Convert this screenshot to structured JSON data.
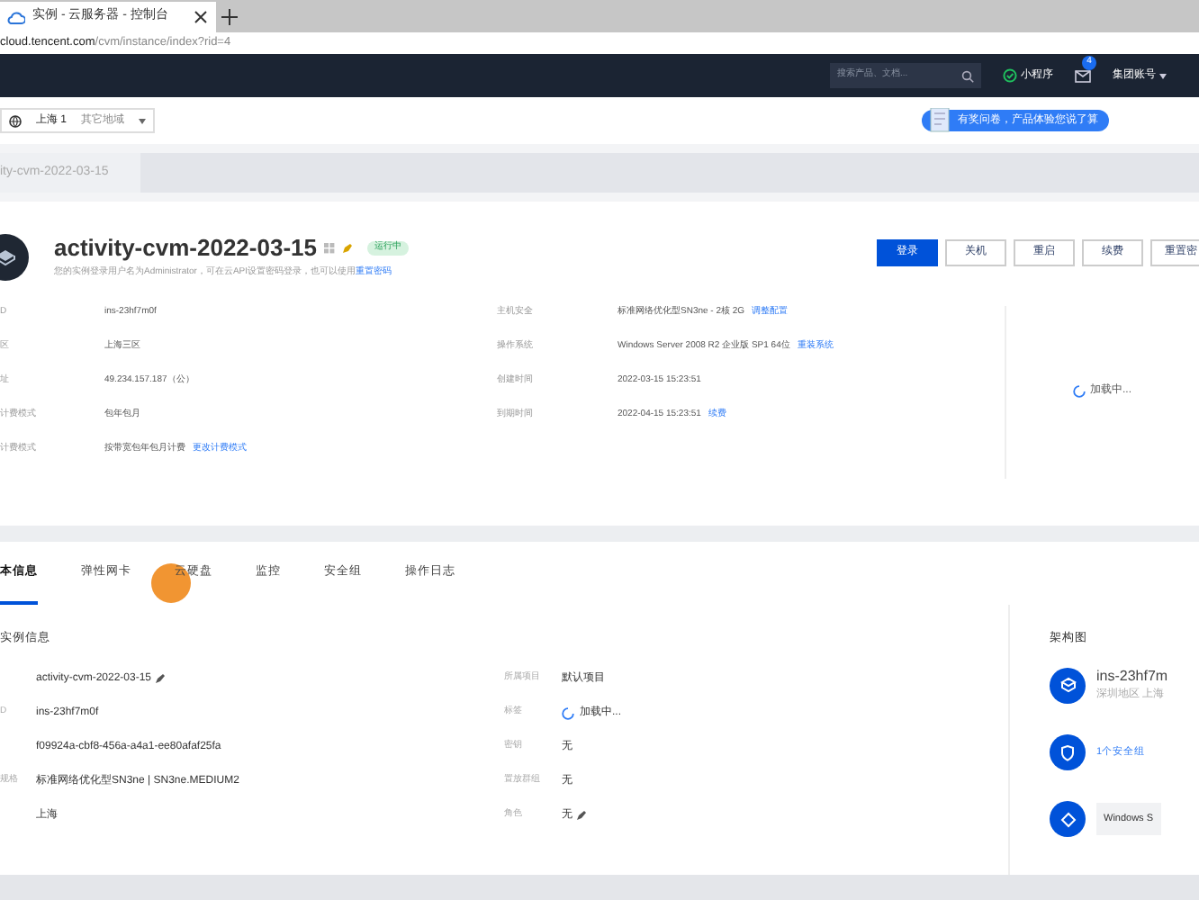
{
  "browser": {
    "tab_title": "实例 - 云服务器 - 控制台",
    "url_host": "cloud.tencent.com",
    "url_path": "/cvm/instance/index?rid=4"
  },
  "topnav": {
    "search_placeholder": "搜索产品、文档...",
    "mini_program": "小程序",
    "mail_badge": "4",
    "account": "集团账号"
  },
  "region_bar": {
    "region": "上海 1",
    "other": "其它地域",
    "survey": "有奖问卷，产品体验您说了算"
  },
  "breadcrumb": "ity-cvm-2022-03-15",
  "instance": {
    "name": "activity-cvm-2022-03-15",
    "status": "运行中",
    "note": "您的实例登录用户名为Administrator，可在云API设置密码登录，也可以使用",
    "note_link": "重置密码",
    "buttons": [
      {
        "label": "登录",
        "primary": true
      },
      {
        "label": "关机",
        "primary": false
      },
      {
        "label": "重启",
        "primary": false
      },
      {
        "label": "续费",
        "primary": false
      },
      {
        "label": "重置密",
        "primary": false
      }
    ],
    "left_fields": [
      {
        "label": "D",
        "value": "ins-23hf7m0f"
      },
      {
        "label": "区",
        "value": "上海三区"
      },
      {
        "label": "址",
        "value": "49.234.157.187（公）"
      },
      {
        "label": "计费模式",
        "value": "包年包月"
      },
      {
        "label": "计费模式",
        "value": "按带宽包年包月计费",
        "link": "更改计费模式"
      }
    ],
    "right_fields": [
      {
        "label": "主机安全",
        "value": "标准网络优化型SN3ne - 2核 2G",
        "link": "调整配置"
      },
      {
        "label": "操作系统",
        "value": "Windows Server 2008 R2 企业版 SP1 64位",
        "link": "重装系统"
      },
      {
        "label": "创建时间",
        "value": "2022-03-15 15:23:51"
      },
      {
        "label": "到期时间",
        "value": "2022-04-15 15:23:51",
        "link": "续费"
      }
    ],
    "loading": "加载中..."
  },
  "tabs": [
    {
      "label": "本信息",
      "selected": true
    },
    {
      "label": "弹性网卡",
      "selected": false
    },
    {
      "label": "云硬盘",
      "selected": false
    },
    {
      "label": "监控",
      "selected": false
    },
    {
      "label": "安全组",
      "selected": false
    },
    {
      "label": "操作日志",
      "selected": false
    }
  ],
  "section_title": "实例信息",
  "info_left": [
    {
      "value": "activity-cvm-2022-03-15",
      "editable": true
    },
    {
      "label": "D",
      "value": "ins-23hf7m0f"
    },
    {
      "value": "f09924a-cbf8-456a-a4a1-ee80afaf25fa"
    },
    {
      "label": "规格",
      "value": "标准网络优化型SN3ne | SN3ne.MEDIUM2"
    },
    {
      "value": "上海"
    }
  ],
  "info_right": [
    {
      "label": "所属项目",
      "value": "默认项目",
      "kind": "text"
    },
    {
      "label": "标签",
      "value": "加载中...",
      "kind": "loading"
    },
    {
      "label": "密钥",
      "value": "无",
      "kind": "text"
    },
    {
      "label": "置放群组",
      "value": "无",
      "kind": "text"
    },
    {
      "label": "角色",
      "value": "无",
      "kind": "editable"
    }
  ],
  "architecture": {
    "title": "架构图",
    "instance_id": "ins-23hf7m",
    "instance_sub": "深圳地区 上海",
    "security_groups": "1个安全组",
    "os": "Windows S"
  }
}
